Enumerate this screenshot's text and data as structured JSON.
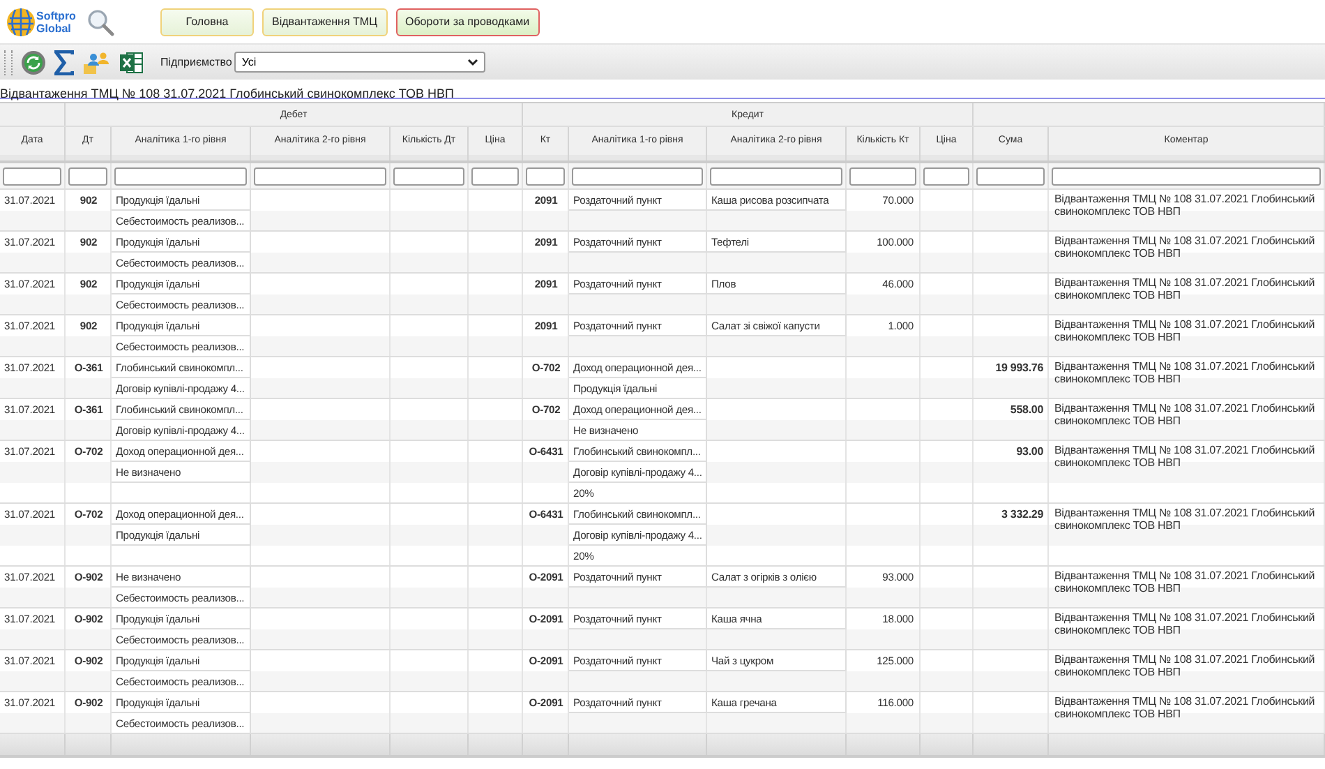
{
  "header": {
    "logo_text": "Softpro Global",
    "nav_buttons": [
      {
        "label": "Головна",
        "selected": false
      },
      {
        "label": "Відвантаження ТМЦ",
        "selected": false
      },
      {
        "label": "Обороти за проводками",
        "selected": true
      }
    ]
  },
  "toolbar": {
    "company_label": "Підприємство",
    "company_value": "Усі"
  },
  "document_title": "Відвантаження ТМЦ № 108 31.07.2021 Глобинський свинокомплекс ТОВ НВП",
  "table": {
    "groups": [
      "Дебет",
      "Кредит"
    ],
    "columns": [
      "Дата",
      "Дт",
      "Аналітика 1-го рівня",
      "Аналітика 2-го рівня",
      "Кількість Дт",
      "Ціна",
      "Кт",
      "Аналітика 1-го рівня",
      "Аналітика 2-го рівня",
      "Кількість Кт",
      "Ціна",
      "Сума",
      "Коментар"
    ],
    "rows": [
      {
        "date": "31.07.2021",
        "dt": "902",
        "dt_lines": [
          "Продукція їдальні",
          "Себестоимость реализов..."
        ],
        "kt": "2091",
        "kt_lines": [
          "Роздаточний пункт"
        ],
        "kt_item": "Каша рисова розсипчата",
        "kt_qty": "70.000",
        "comment": "Відвантаження ТМЦ № 108 31.07.2021 Глобинський свинокомплекс ТОВ НВП"
      },
      {
        "date": "31.07.2021",
        "dt": "902",
        "dt_lines": [
          "Продукція їдальні",
          "Себестоимость реализов..."
        ],
        "kt": "2091",
        "kt_lines": [
          "Роздаточний пункт"
        ],
        "kt_item": "Тефтелі",
        "kt_qty": "100.000",
        "comment": "Відвантаження ТМЦ № 108 31.07.2021 Глобинський свинокомплекс ТОВ НВП"
      },
      {
        "date": "31.07.2021",
        "dt": "902",
        "dt_lines": [
          "Продукція їдальні",
          "Себестоимость реализов..."
        ],
        "kt": "2091",
        "kt_lines": [
          "Роздаточний пункт"
        ],
        "kt_item": "Плов",
        "kt_qty": "46.000",
        "comment": "Відвантаження ТМЦ № 108 31.07.2021 Глобинський свинокомплекс ТОВ НВП"
      },
      {
        "date": "31.07.2021",
        "dt": "902",
        "dt_lines": [
          "Продукція їдальні",
          "Себестоимость реализов..."
        ],
        "kt": "2091",
        "kt_lines": [
          "Роздаточний пункт"
        ],
        "kt_item": "Салат зі свіжої капусти",
        "kt_qty": "1.000",
        "comment": "Відвантаження ТМЦ № 108 31.07.2021 Глобинський свинокомплекс ТОВ НВП"
      },
      {
        "date": "31.07.2021",
        "dt": "О-361",
        "dt_lines": [
          "Глобинський свинокомпл...",
          "Договір купівлі-продажу 4..."
        ],
        "kt": "О-702",
        "kt_lines": [
          "Доход операционной дея...",
          "Продукція їдальні"
        ],
        "sum": "19 993.76",
        "comment": "Відвантаження ТМЦ № 108 31.07.2021 Глобинський свинокомплекс ТОВ НВП"
      },
      {
        "date": "31.07.2021",
        "dt": "О-361",
        "dt_lines": [
          "Глобинський свинокомпл...",
          "Договір купівлі-продажу 4..."
        ],
        "kt": "О-702",
        "kt_lines": [
          "Доход операционной дея...",
          "Не визначено"
        ],
        "sum": "558.00",
        "comment": "Відвантаження ТМЦ № 108 31.07.2021 Глобинський свинокомплекс ТОВ НВП"
      },
      {
        "date": "31.07.2021",
        "dt": "О-702",
        "dt_lines": [
          "Доход операционной дея...",
          "Не визначено"
        ],
        "kt": "О-6431",
        "kt_lines": [
          "Глобинський свинокомпл...",
          "Договір купівлі-продажу 4...",
          "20%"
        ],
        "sum": "93.00",
        "comment": "Відвантаження ТМЦ № 108 31.07.2021 Глобинський свинокомплекс ТОВ НВП"
      },
      {
        "date": "31.07.2021",
        "dt": "О-702",
        "dt_lines": [
          "Доход операционной дея...",
          "Продукція їдальні"
        ],
        "kt": "О-6431",
        "kt_lines": [
          "Глобинський свинокомпл...",
          "Договір купівлі-продажу 4...",
          "20%"
        ],
        "sum": "3 332.29",
        "comment": "Відвантаження ТМЦ № 108 31.07.2021 Глобинський свинокомплекс ТОВ НВП"
      },
      {
        "date": "31.07.2021",
        "dt": "О-902",
        "dt_lines": [
          "Не визначено",
          "Себестоимость реализов..."
        ],
        "kt": "О-2091",
        "kt_lines": [
          "Роздаточний пункт"
        ],
        "kt_item": "Салат з огірків з олією",
        "kt_qty": "93.000",
        "comment": "Відвантаження ТМЦ № 108 31.07.2021 Глобинський свинокомплекс ТОВ НВП"
      },
      {
        "date": "31.07.2021",
        "dt": "О-902",
        "dt_lines": [
          "Продукція їдальні",
          "Себестоимость реализов..."
        ],
        "kt": "О-2091",
        "kt_lines": [
          "Роздаточний пункт"
        ],
        "kt_item": "Каша ячна",
        "kt_qty": "18.000",
        "comment": "Відвантаження ТМЦ № 108 31.07.2021 Глобинський свинокомплекс ТОВ НВП"
      },
      {
        "date": "31.07.2021",
        "dt": "О-902",
        "dt_lines": [
          "Продукція їдальні",
          "Себестоимость реализов..."
        ],
        "kt": "О-2091",
        "kt_lines": [
          "Роздаточний пункт"
        ],
        "kt_item": "Чай з цукром",
        "kt_qty": "125.000",
        "comment": "Відвантаження ТМЦ № 108 31.07.2021 Глобинський свинокомплекс ТОВ НВП"
      },
      {
        "date": "31.07.2021",
        "dt": "О-902",
        "dt_lines": [
          "Продукція їдальні",
          "Себестоимость реализов..."
        ],
        "kt": "О-2091",
        "kt_lines": [
          "Роздаточний пункт"
        ],
        "kt_item": "Каша гречана",
        "kt_qty": "116.000",
        "comment": "Відвантаження ТМЦ № 108 31.07.2021 Глобинський свинокомплекс ТОВ НВП"
      }
    ]
  }
}
